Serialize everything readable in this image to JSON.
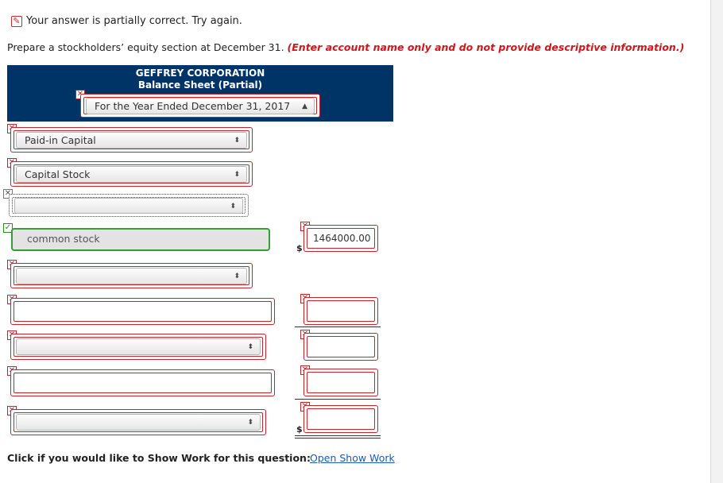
{
  "status": {
    "text": "Your answer is partially correct.  Try again.",
    "icon": "pencil-icon"
  },
  "instruction": {
    "text": "Prepare a stockholders’ equity section at December 31.",
    "note": "(Enter account name only and do not provide descriptive information.)"
  },
  "header": {
    "company": "GEFFREY CORPORATION",
    "subtitle": "Balance Sheet (Partial)",
    "period_select": "For the Year Ended December 31, 2017"
  },
  "rows": {
    "r1_select": "Paid-in Capital",
    "r2_select": "Capital Stock",
    "r3_select": "",
    "r4_account": "common stock",
    "r4_amount": "1464000.00",
    "r4_currency": "$",
    "r5_select": "",
    "r6_text": "",
    "r6_amount": "",
    "r7_select": "",
    "r7_amount": "",
    "r8_text": "",
    "r8_amount": "",
    "r9_select": "",
    "r9_amount": "",
    "r9_currency": "$"
  },
  "footer": {
    "label": "Click if you would like to Show Work for this question:",
    "link": "Open Show Work"
  },
  "colors": {
    "header_bg": "#003366",
    "error": "#c1272d",
    "correct": "#3a9a3a",
    "note_red": "#d0161c",
    "link": "#1a5bb5"
  }
}
